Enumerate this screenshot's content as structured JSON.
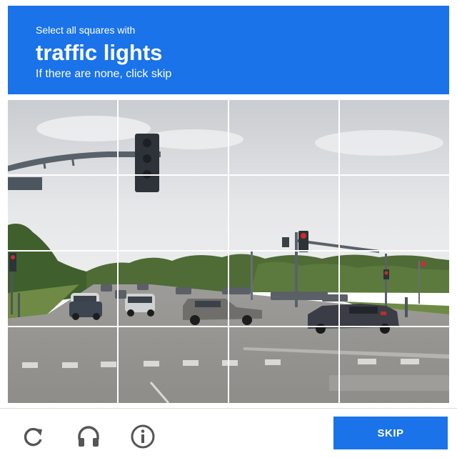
{
  "header": {
    "prompt": "Select all squares with",
    "target": "traffic lights",
    "hint": "If there are none, click skip"
  },
  "grid": {
    "rows": 4,
    "columns": 4
  },
  "footer": {
    "icons": [
      "reload-icon",
      "audio-headphones-icon",
      "info-icon"
    ],
    "skip_label": "SKIP"
  },
  "colors": {
    "accent": "#1a73e8"
  }
}
